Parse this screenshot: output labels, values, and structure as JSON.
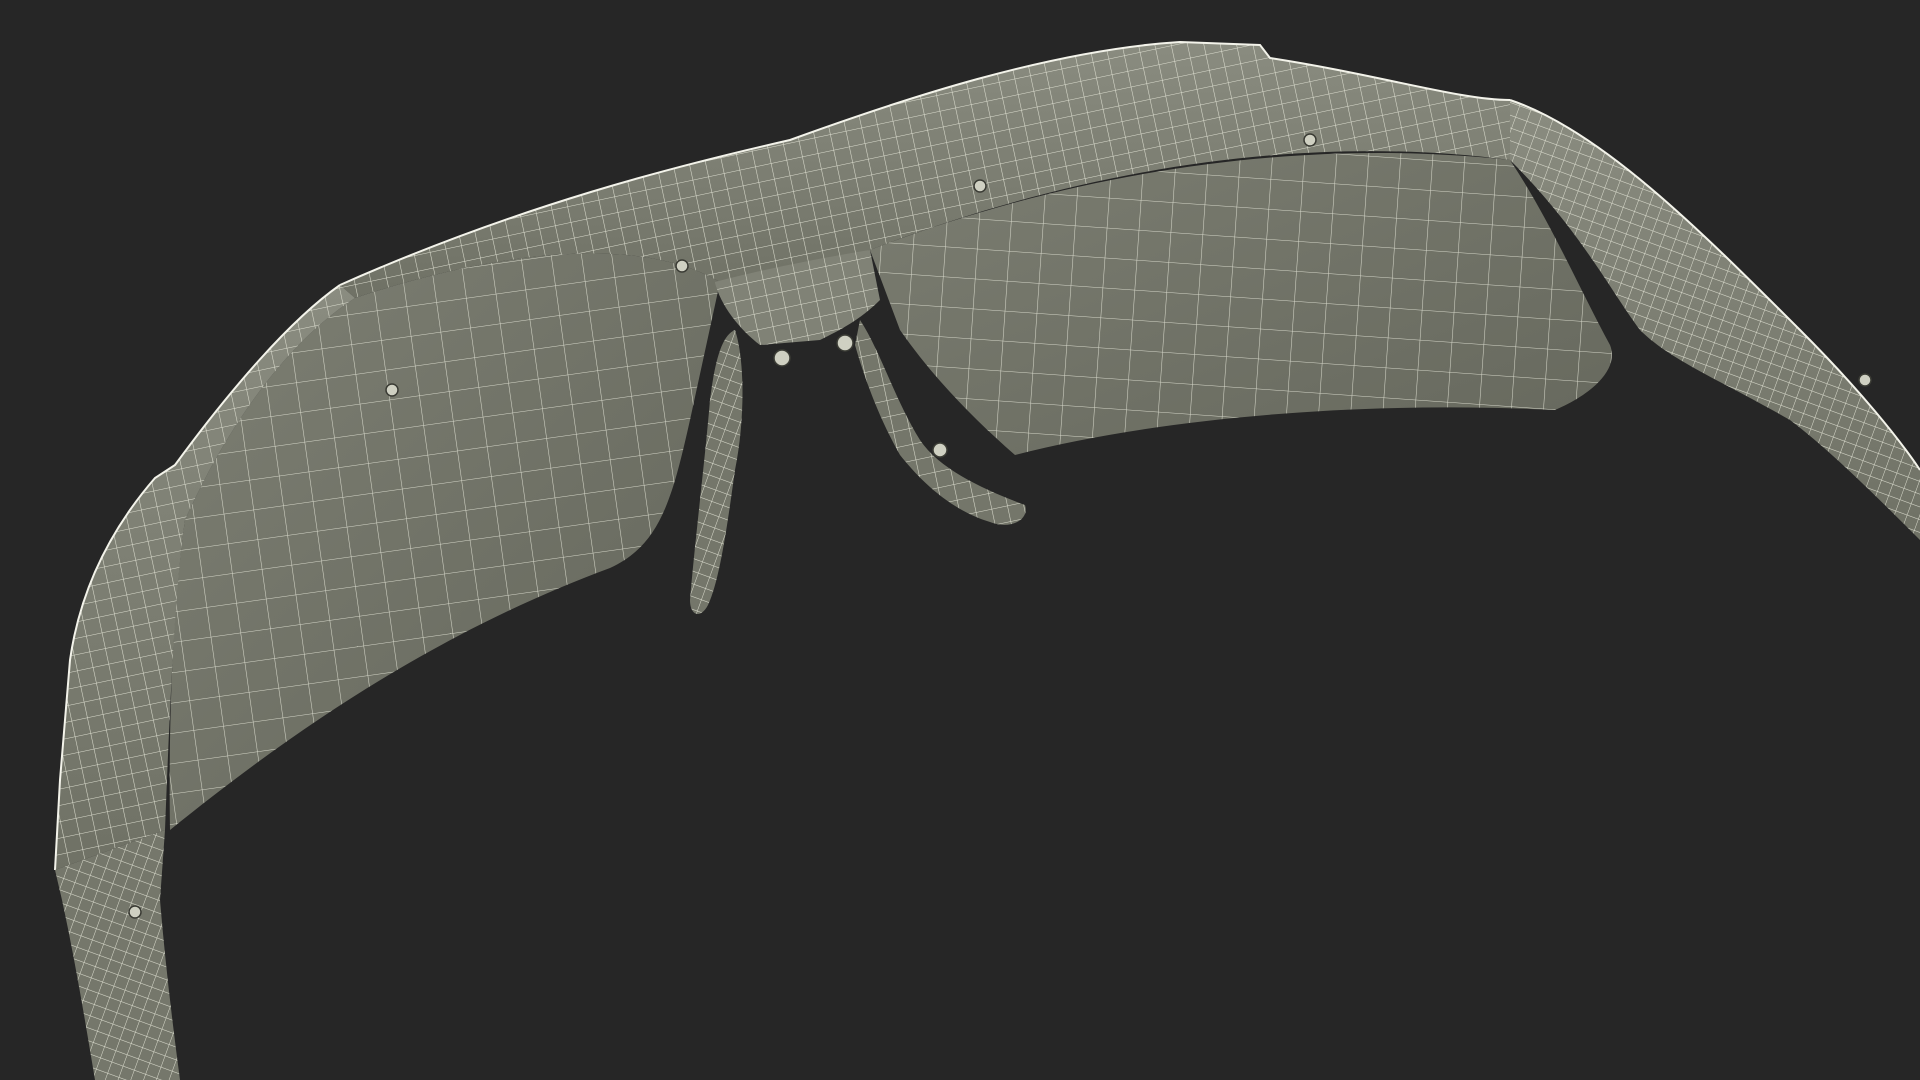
{
  "scene": {
    "subject": "wireframe-glasses-frame",
    "colors": {
      "background": "#262626",
      "surface_light": "#7f8175",
      "surface_mid": "#6c6e62",
      "surface_dark": "#5c5e53",
      "wire": "#e7e8da",
      "edge": "#f3f3ea"
    }
  }
}
